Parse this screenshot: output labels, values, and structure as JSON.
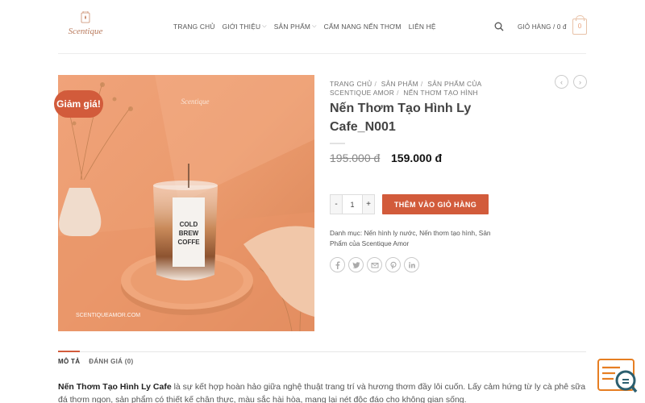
{
  "header": {
    "logo_text": "Scentique",
    "nav": [
      {
        "label": "TRANG CHỦ",
        "has_dropdown": false
      },
      {
        "label": "GIỚI THIỆU",
        "has_dropdown": true
      },
      {
        "label": "SẢN PHẨM",
        "has_dropdown": true
      },
      {
        "label": "CẨM NANG NẾN THƠM",
        "has_dropdown": false
      },
      {
        "label": "LIÊN HỆ",
        "has_dropdown": false
      }
    ],
    "cart_label": "GIỎ HÀNG / 0 đ",
    "cart_count": "0"
  },
  "product": {
    "sale_badge": "Giảm giá!",
    "image": {
      "watermark": "SCENTIQUEAMOR.COM",
      "label_lines": [
        "COLD",
        "BREW",
        "COFFE"
      ],
      "brand": "Scentique"
    },
    "breadcrumb": [
      "TRANG CHỦ",
      "SẢN PHẨM",
      "SẢN PHẨM CỦA SCENTIQUE AMOR",
      "NẾN THƠM TẠO HÌNH"
    ],
    "title": "Nến Thơm Tạo Hình Ly Cafe_N001",
    "old_price": "195.000 đ",
    "new_price": "159.000 đ",
    "quantity": "1",
    "qty_minus": "-",
    "qty_plus": "+",
    "add_to_cart": "THÊM VÀO GIỎ HÀNG",
    "categories_label": "Danh mục:",
    "categories": "Nến hình ly nước, Nến thơm tạo hình, Sản Phẩm của Scentique Amor",
    "share_icons": [
      "facebook-icon",
      "twitter-icon",
      "email-icon",
      "pinterest-icon",
      "linkedin-icon"
    ]
  },
  "tabs": [
    {
      "label": "MÔ TẢ",
      "active": true
    },
    {
      "label": "ĐÁNH GIÁ (0)",
      "active": false
    }
  ],
  "description": {
    "bold": "Nến Thơm Tạo Hình Ly Cafe",
    "text": " là sự kết hợp hoàn hảo giữa nghệ thuật trang trí và hương thơm đầy lôi cuốn. Lấy cảm hứng từ ly cà phê sữa đá thơm ngon, sản phẩm có thiết kế chân thực, màu sắc hài hòa, mang lại nét độc đáo cho không gian sống."
  },
  "colors": {
    "accent": "#d25b3b",
    "image_bg": "#e9986a"
  }
}
